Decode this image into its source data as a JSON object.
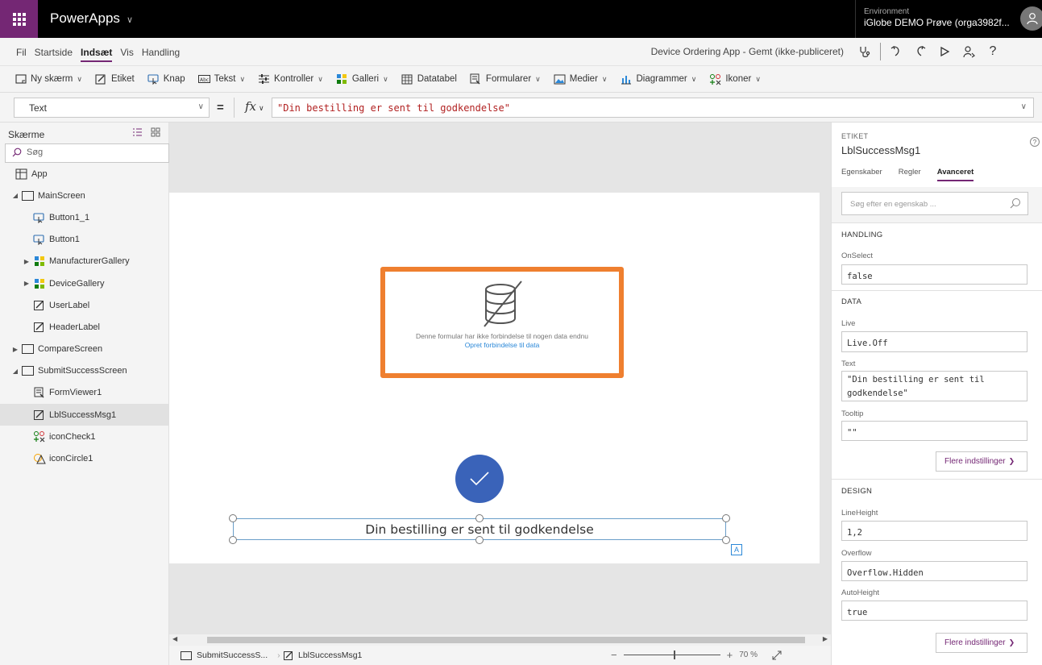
{
  "topbar": {
    "app_name": "PowerApps",
    "env_label": "Environment",
    "env_value": "iGlobe DEMO Prøve (orga3982f..."
  },
  "menu": {
    "items": [
      "Fil",
      "Startside",
      "Indsæt",
      "Vis",
      "Handling"
    ],
    "active": "Indsæt",
    "doc_title": "Device Ordering App - Gemt (ikke-publiceret)"
  },
  "toolbar": {
    "new_screen": "Ny skærm",
    "label": "Etiket",
    "button": "Knap",
    "text": "Tekst",
    "controls": "Kontroller",
    "gallery": "Galleri",
    "datatable": "Datatabel",
    "forms": "Formularer",
    "media": "Medier",
    "charts": "Diagrammer",
    "icons": "Ikoner"
  },
  "formula_bar": {
    "property": "Text",
    "equals": "=",
    "fx": "fx",
    "formula": "\"Din bestilling er sent til godkendelse\""
  },
  "left_panel": {
    "title": "Skærme",
    "search_placeholder": "Søg",
    "tree": [
      {
        "label": "App",
        "indent": 0,
        "icon": "app",
        "arrow": ""
      },
      {
        "label": "MainScreen",
        "indent": 0,
        "icon": "screen",
        "arrow": "open"
      },
      {
        "label": "Button1_1",
        "indent": 1,
        "icon": "button",
        "arrow": ""
      },
      {
        "label": "Button1",
        "indent": 1,
        "icon": "button",
        "arrow": ""
      },
      {
        "label": "ManufacturerGallery",
        "indent": 1,
        "icon": "gallery",
        "arrow": "closed"
      },
      {
        "label": "DeviceGallery",
        "indent": 1,
        "icon": "gallery",
        "arrow": "closed"
      },
      {
        "label": "UserLabel",
        "indent": 1,
        "icon": "label",
        "arrow": ""
      },
      {
        "label": "HeaderLabel",
        "indent": 1,
        "icon": "label",
        "arrow": ""
      },
      {
        "label": "CompareScreen",
        "indent": 0,
        "icon": "screen",
        "arrow": "closed"
      },
      {
        "label": "SubmitSuccessScreen",
        "indent": 0,
        "icon": "screen",
        "arrow": "open"
      },
      {
        "label": "FormViewer1",
        "indent": 1,
        "icon": "form",
        "arrow": ""
      },
      {
        "label": "LblSuccessMsg1",
        "indent": 1,
        "icon": "label",
        "arrow": "",
        "selected": true
      },
      {
        "label": "iconCheck1",
        "indent": 1,
        "icon": "icons",
        "arrow": ""
      },
      {
        "label": "iconCircle1",
        "indent": 1,
        "icon": "shape",
        "arrow": ""
      }
    ]
  },
  "canvas": {
    "form_msg": "Denne formular har ikke forbindelse til nogen data endnu",
    "form_link": "Opret forbindelse til data",
    "label_text": "Din bestilling er sent til godkendelse",
    "a_badge": "A"
  },
  "statusbar": {
    "screen_crumb": "SubmitSuccessS...",
    "control_crumb": "LblSuccessMsg1",
    "zoom_minus": "−",
    "zoom_plus": "+",
    "zoom_value": "70 %"
  },
  "right_panel": {
    "type": "ETIKET",
    "name": "LblSuccessMsg1",
    "help": "?",
    "tabs": [
      "Egenskaber",
      "Regler",
      "Avanceret"
    ],
    "active_tab": "Avanceret",
    "search_placeholder": "Søg efter en egenskab ...",
    "handling_title": "HANDLING",
    "onselect_label": "OnSelect",
    "onselect_value": "false",
    "data_title": "DATA",
    "live_label": "Live",
    "live_value": "Live.Off",
    "text_label": "Text",
    "text_value": "\"Din bestilling er sent til godkendelse\"",
    "tooltip_label": "Tooltip",
    "tooltip_value": "\"\"",
    "more_settings": "Flere indstillinger",
    "design_title": "DESIGN",
    "lineheight_label": "LineHeight",
    "lineheight_value": "1,2",
    "overflow_label": "Overflow",
    "overflow_value": "Overflow.Hidden",
    "autoheight_label": "AutoHeight",
    "autoheight_value": "true"
  }
}
